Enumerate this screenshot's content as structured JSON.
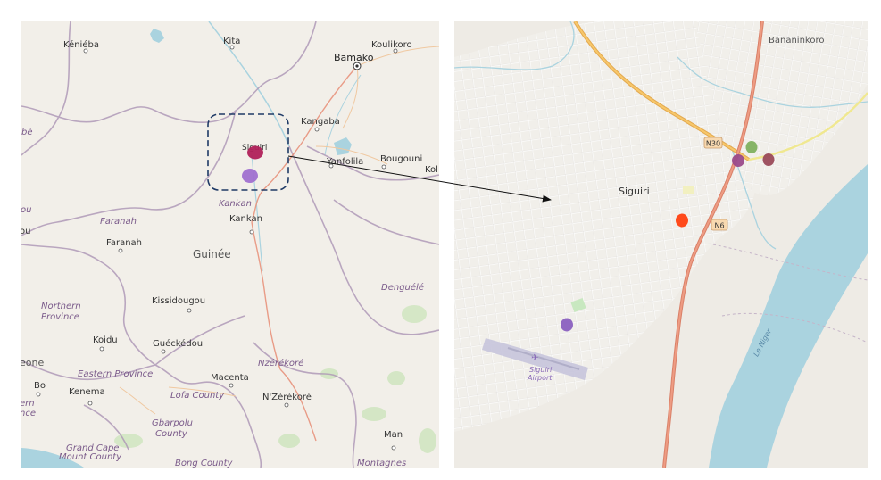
{
  "left_map": {
    "places": {
      "kenieba": "Kéniéba",
      "kita": "Kita",
      "bamako": "Bamako",
      "koulikoro": "Koulikoro",
      "kangaba": "Kangaba",
      "siguiri": "Siguiri",
      "bougouni": "Bougouni",
      "kol": "Kol",
      "yanfolila": "Yanfolila",
      "kankan_region": "Kankan",
      "kankan": "Kankan",
      "faranah_region": "Faranah",
      "faranah": "Faranah",
      "guinee": "Guinée",
      "denguele": "Denguélé",
      "northern_province": "Northern\nProvince",
      "kissidougou": "Kissidougou",
      "koidu": "Koidu",
      "gueckedou": "Guéckédou",
      "macenta": "Macenta",
      "nzerekore_region": "Nzérékoré",
      "eastern_province": "Eastern Province",
      "kenema": "Kenema",
      "bo": "Bo",
      "lofa_county": "Lofa County",
      "nzerekore": "N'Zérékoré",
      "gbarpolu_county": "Gbarpolu\nCounty",
      "man": "Man",
      "grand_cape_mount_county": "Grand Cape\nMount County",
      "bong_county": "Bong County",
      "montagnes": "Montagnes",
      "edge_be": "bé",
      "edge_ou": "ou",
      "edge_ou2": "ou",
      "edge_eone": "eone",
      "edge_ern": "ern",
      "edge_nce": "nce"
    }
  },
  "right_map": {
    "places": {
      "siguiri": "Siguiri",
      "bananinkoro": "Bananinkoro",
      "airport": "Siguiri\nAirport",
      "river": "Le Niger"
    },
    "roads": {
      "n30": "N30",
      "n6": "N6"
    }
  },
  "markers": {
    "left": [
      {
        "color": "#b0205a",
        "name": "marker-crimson"
      },
      {
        "color": "#a070d0",
        "name": "marker-lavender"
      }
    ],
    "right": [
      {
        "color": "#80b060",
        "name": "marker-green"
      },
      {
        "color": "#9a4a8a",
        "name": "marker-purple"
      },
      {
        "color": "#9a4a5a",
        "name": "marker-maroon"
      },
      {
        "color": "#ff4010",
        "name": "marker-red-orange"
      },
      {
        "color": "#8a60c0",
        "name": "marker-violet"
      }
    ]
  },
  "colors": {
    "land": "#f2efe9",
    "water": "#aad3df",
    "boundary": "#b09ab8",
    "road_primary": "#e8927c",
    "road_trunk": "#f0b060",
    "highlight_box": "#1f3a66"
  }
}
